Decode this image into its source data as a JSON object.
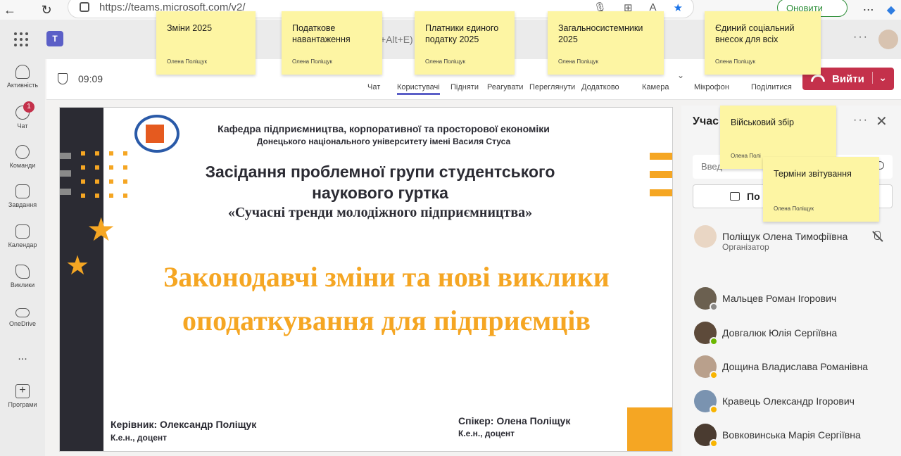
{
  "browser": {
    "url": "https://teams.microsoft.com/v2/",
    "update_label": "Оновити"
  },
  "header": {
    "search_hint": "+Alt+E)"
  },
  "rail": [
    {
      "label": "Активність",
      "icon": "bell-icon"
    },
    {
      "label": "Чат",
      "icon": "chat-icon",
      "badge": "1"
    },
    {
      "label": "Команди",
      "icon": "teams-icon"
    },
    {
      "label": "Завдання",
      "icon": "tasks-icon"
    },
    {
      "label": "Календар",
      "icon": "calendar-icon"
    },
    {
      "label": "Виклики",
      "icon": "phone-icon"
    },
    {
      "label": "OneDrive",
      "icon": "cloud-icon"
    },
    {
      "label": "...",
      "icon": "more-icon"
    },
    {
      "label": "Програми",
      "icon": "add-apps-icon"
    }
  ],
  "meeting": {
    "time": "09:09",
    "tools": [
      "Чат",
      "Користувачі",
      "Підняти",
      "Реагувати",
      "Переглянути",
      "Додатково",
      "Камера",
      "Мікрофон",
      "Поділитися"
    ],
    "active_tool": "Користувачі",
    "leave_label": "Вийти"
  },
  "slide": {
    "department": "Кафедра підприємництва, корпоративної та просторової економіки",
    "university": "Донецького національного університету імені Василя Стуса",
    "group_line1": "Засідання проблемної групи студентського",
    "group_line2": "наукового гуртка",
    "theme": "«Сучасні тренди молодіжного підприємництва»",
    "main_line1": "Законодавчі зміни та нові виклики",
    "main_line2": "оподаткування для підприємців",
    "supervisor": "Керівник: Олександр Поліщук",
    "supervisor_title": "К.е.н., доцент",
    "speaker": "Спікер: Олена Поліщук",
    "speaker_title": "К.е.н., доцент"
  },
  "panel": {
    "title": "Учас",
    "search_placeholder": "Введ",
    "share_label": "По",
    "organizer": {
      "name": "Поліщук Олена Тимофіївна",
      "role": "Організатор"
    },
    "participants": [
      {
        "name": "Мальцев Роман Ігорович",
        "status_color": "#8a8886"
      },
      {
        "name": "Довгалюк Юлія Сергіївна",
        "status_color": "#6bb700"
      },
      {
        "name": "Дощина Владислава Романівна",
        "status_color": "#f8b400"
      },
      {
        "name": "Кравець Олександр Ігорович",
        "status_color": "#f8b400"
      },
      {
        "name": "Вовковинська Марія Сергіївна",
        "status_color": "#f8b400"
      }
    ]
  },
  "notes": [
    {
      "text": "Зміни 2025",
      "author": "Олена Поліщук"
    },
    {
      "text": "Податкове навантаження",
      "author": "Олена Поліщук"
    },
    {
      "text": "Платники єдиного податку 2025",
      "author": "Олена Поліщук"
    },
    {
      "text": "Загальносистемники 2025",
      "author": "Олена Поліщук"
    },
    {
      "text": "Єдиний соціальний внесок для всіх",
      "author": "Олена Поліщук"
    },
    {
      "text": "Військовий збір",
      "author": "Олена Полі"
    },
    {
      "text": "Терміни звітування",
      "author": "Олена Поліщук"
    }
  ],
  "colors": {
    "accent": "#5b5fc7",
    "leave": "#c4314b",
    "slide_orange": "#f5a623",
    "note": "#fdf5a3"
  }
}
